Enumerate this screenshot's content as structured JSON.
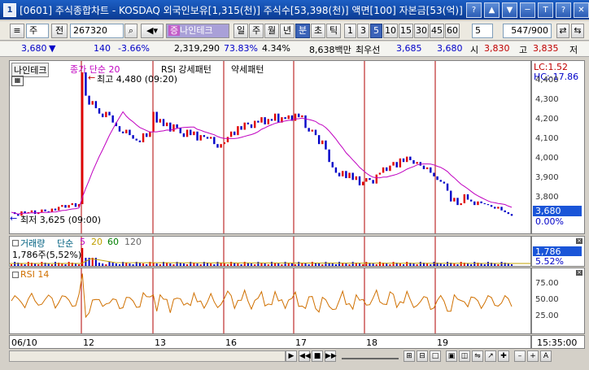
{
  "window": {
    "icon_text": "1",
    "title": "[0601] 주식종합차트 - KOSDAQ 외국인보유[1,315(천)] 주식수[53,398(천)] 액면[100] 자본금[53(억)]",
    "buttons": [
      "?",
      "▲",
      "▼",
      "─",
      "T",
      "?",
      "✕"
    ]
  },
  "toolbar": {
    "mode_select": "주",
    "prev_label": "전",
    "code_value": "267320",
    "stock_name": "나인테크",
    "periods": [
      "일",
      "주",
      "월",
      "년",
      "분",
      "초",
      "틱"
    ],
    "selected_period": "분",
    "intervals": [
      "1",
      "3",
      "5",
      "10",
      "15",
      "30",
      "45",
      "60"
    ],
    "selected_interval": "5",
    "count_select": "5",
    "range_value": "547/900"
  },
  "quote": {
    "price": "3,680",
    "change": "140",
    "change_pct": "-3.66%",
    "volume": "2,319,290",
    "ratio": "73.83%",
    "turnover_pct": "4.34%",
    "amount": "8,638백만",
    "best_ask_label": "최우선",
    "best_ask": "3,685",
    "best_bid": "3,680",
    "open_label": "시",
    "open": "3,830",
    "high_label": "고",
    "high": "3,835",
    "low_label": "저"
  },
  "price_panel": {
    "stock_tag": "나인테크",
    "ma_label": "종가 단순 20",
    "rsi_pattern_label": "RSI 강세패턴",
    "weak_label": "약세패턴",
    "high_note": "최고 4,480 (09:20)",
    "low_note": "최저 3,625 (09:00)",
    "lc": "LC:1.52",
    "hc": "HC:-17.86",
    "current": "3,680",
    "current_pct": "0.00%",
    "ticks": [
      "4,400",
      "4,300",
      "4,200",
      "4,100",
      "4,000",
      "3,900",
      "3,800",
      "3,700"
    ]
  },
  "volume_panel": {
    "title": "거래량",
    "ma_prefix": "단순",
    "ma5": "5",
    "ma20": "20",
    "ma60": "60",
    "ma120": "120",
    "value_note": "1,786주(5,52%)",
    "current": "1,786",
    "current_pct": "5.52%"
  },
  "rsi_panel": {
    "title": "RSI 14",
    "ticks": [
      "75.00",
      "50.00",
      "25.00"
    ]
  },
  "x_axis": {
    "labels": [
      "06/10",
      "12",
      "13",
      "16",
      "17",
      "18",
      "19"
    ],
    "time": "15:35:00"
  },
  "colors": {
    "up": "#e00000",
    "down": "#0000c8",
    "ma": "#c000c0",
    "rsi": "#d07000",
    "current_box": "#1a55d8",
    "separator": "#b00000"
  },
  "chart_data": {
    "type": "line",
    "title": "",
    "price_ylim": [
      3600,
      4480
    ],
    "price": [
      3700,
      3690,
      3680,
      3705,
      3695,
      3700,
      3710,
      3690,
      3700,
      3715,
      3705,
      3700,
      3720,
      3710,
      3730,
      3740,
      3725,
      3740,
      3750,
      3730,
      3745,
      4480,
      4350,
      4300,
      4320,
      4280,
      4250,
      4230,
      4260,
      4240,
      4200,
      4180,
      4150,
      4140,
      4160,
      4130,
      4110,
      4100,
      4090,
      4140,
      4120,
      4150,
      4260,
      4200,
      4220,
      4180,
      4200,
      4150,
      4190,
      4170,
      4140,
      4120,
      4160,
      4130,
      4150,
      4100,
      4130,
      4120,
      4110,
      4120,
      4080,
      4060,
      4080,
      4090,
      4120,
      4150,
      4130,
      4180,
      4160,
      4200,
      4190,
      4170,
      4210,
      4200,
      4230,
      4190,
      4220,
      4210,
      4250,
      4200,
      4230,
      4220,
      4240,
      4210,
      4250,
      4230,
      4240,
      4170,
      4150,
      4160,
      4130,
      4080,
      4100,
      4050,
      3980,
      3950,
      3920,
      3900,
      3930,
      3890,
      3920,
      3880,
      3900,
      3850,
      3870,
      3890,
      3880,
      3860,
      3910,
      3920,
      3950,
      3930,
      3960,
      3980,
      3950,
      4000,
      3980,
      4010,
      3990,
      3970,
      3980,
      3960,
      3940,
      3950,
      3920,
      3900,
      3880,
      3870,
      3860,
      3820,
      3760,
      3780,
      3740,
      3750,
      3800,
      3770,
      3760,
      3740,
      3760,
      3750,
      3745,
      3740,
      3730,
      3720,
      3730,
      3710,
      3700,
      3690,
      3680
    ]
  }
}
